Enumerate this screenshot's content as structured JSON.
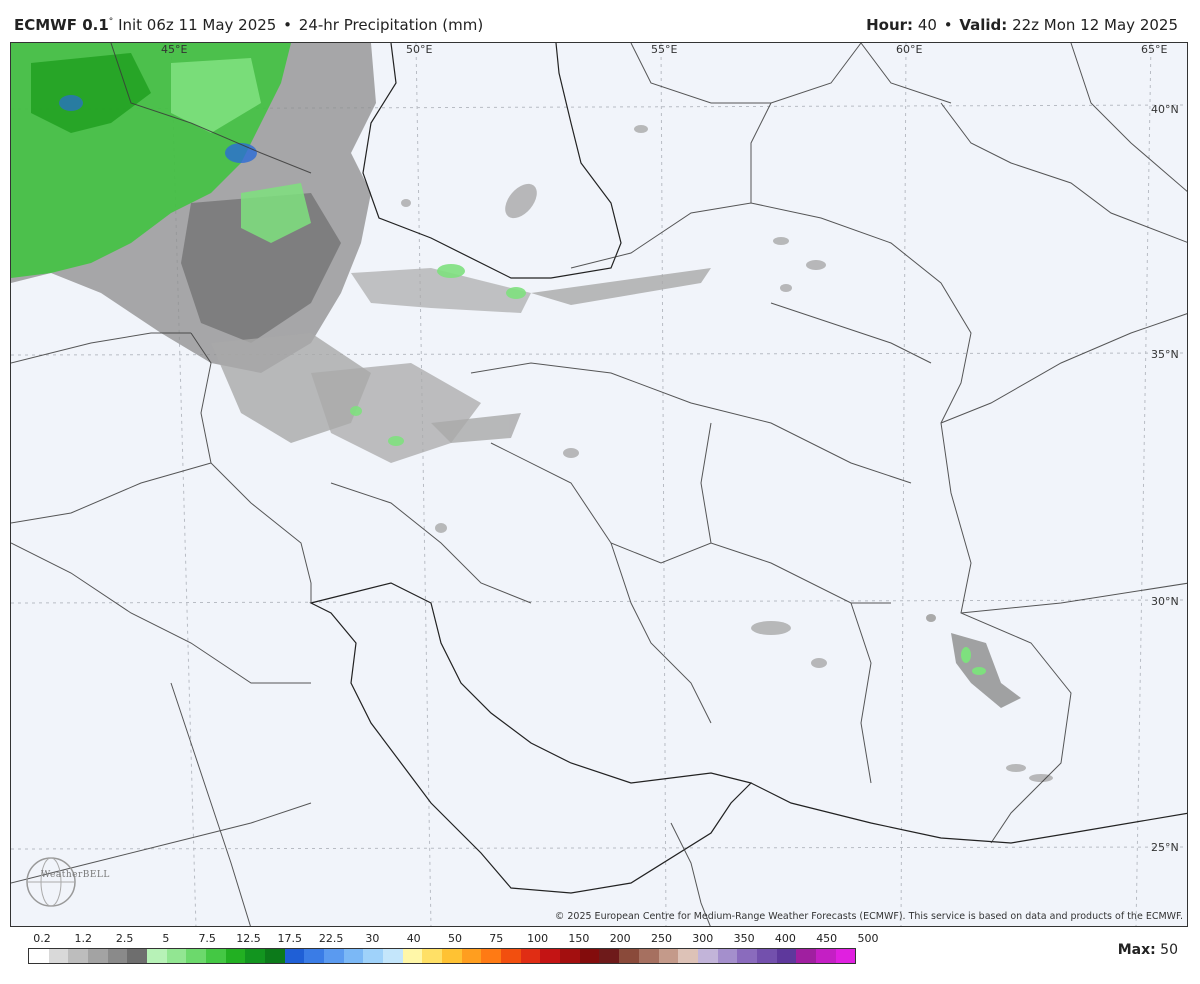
{
  "header": {
    "model": "ECMWF 0.1",
    "degree": "°",
    "init": "Init 06z 11 May 2025",
    "bullet": "•",
    "product": "24-hr Precipitation (mm)",
    "hour_label": "Hour:",
    "hour_value": "40",
    "valid_label": "Valid:",
    "valid_value": "22z Mon 12 May 2025"
  },
  "map": {
    "lon_labels": [
      "50°E",
      "55°E",
      "60°E",
      "65°E"
    ],
    "lat_labels": [
      "40°N",
      "35°N",
      "30°N",
      "25°N"
    ],
    "small_labels": [
      "45°E"
    ],
    "copyright": "© 2025 European Centre for Medium-Range Weather Forecasts (ECMWF). This service is based on data and products of the ECMWF.",
    "logo_text": "WeatherBELL",
    "colors": {
      "background": "#f1f4fa",
      "border": "#555555",
      "grid": "#b8bcc4",
      "light_precip": "#a9a9a9",
      "mid_precip": "#8c8c8c",
      "dark_precip": "#6e6e6e",
      "green_light": "#7ee07e",
      "green_mid": "#3cc43c",
      "green_dark": "#1e9e1e",
      "blue": "#2a6bd6"
    }
  },
  "legend": {
    "labels": [
      "0.2",
      "1.2",
      "2.5",
      "5",
      "7.5",
      "12.5",
      "17.5",
      "22.5",
      "30",
      "40",
      "50",
      "75",
      "100",
      "150",
      "200",
      "250",
      "300",
      "350",
      "400",
      "450",
      "500"
    ],
    "colors": [
      "#ffffff",
      "#d9d9d9",
      "#bdbdbd",
      "#a3a3a3",
      "#8a8a8a",
      "#6e6e6e",
      "#b7f2b7",
      "#92e692",
      "#6cd96c",
      "#44c844",
      "#22b022",
      "#12951f",
      "#0c7a1a",
      "#1f5fd6",
      "#3a7ce6",
      "#5a9af0",
      "#7bb8f6",
      "#9fd2fa",
      "#c4e6fb",
      "#fff7a8",
      "#ffe066",
      "#ffc233",
      "#ff9e1f",
      "#ff7a14",
      "#f24f0f",
      "#e02d14",
      "#c41414",
      "#a30f0f",
      "#830c0c",
      "#6e1a1a",
      "#8a4a3a",
      "#a67060",
      "#c49a8a",
      "#ddc2b7",
      "#c2b4d9",
      "#a48fcc",
      "#8a6bbd",
      "#7350ad",
      "#5e389c",
      "#a01fa0",
      "#c41fc4",
      "#e020e0"
    ],
    "max_label": "Max:",
    "max_value": "50"
  }
}
